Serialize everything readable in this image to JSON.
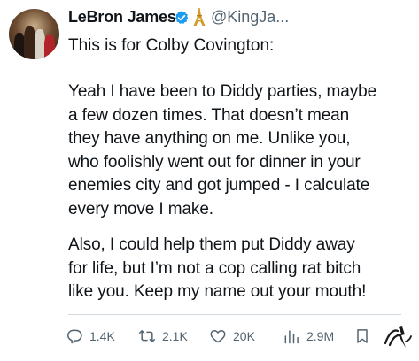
{
  "tweet": {
    "author_name": "LeBron James",
    "handle": "@KingJa...",
    "line1": "This is for Colby Covington:",
    "paragraph1": "Yeah I have been to Diddy parties, maybe\na few dozen times. That doesn’t mean\nthey have anything on me. Unlike you,\nwho foolishly went out for dinner in your\nenemies city and got jumped - I calculate\nevery move I make.",
    "paragraph2": "Also, I could help them put Diddy away\nfor life, but I’m not a cop calling rat bitch\nlike you.  Keep my name out your mouth!"
  },
  "actions": {
    "replies": "1.4K",
    "reposts": "2.1K",
    "likes": "20K",
    "views": "2.9M"
  },
  "colors": {
    "verified": "#1d9bf0",
    "secondary_text": "#536471",
    "divider": "#cfd9de"
  },
  "icons": [
    "verified-badge-icon",
    "eiffel-tower-emoji-icon",
    "reply-icon",
    "repost-icon",
    "like-icon",
    "views-icon",
    "bookmark-icon",
    "watermark-logo"
  ]
}
